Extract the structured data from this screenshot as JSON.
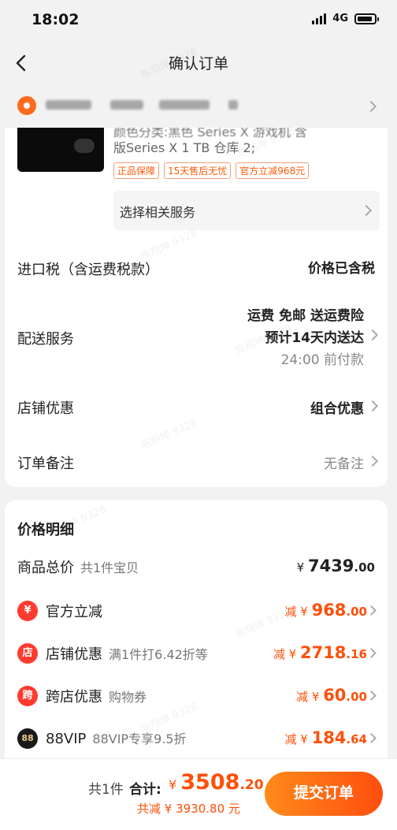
{
  "status": {
    "time": "18:02",
    "network": "4G"
  },
  "nav": {
    "title": "确认订单"
  },
  "product": {
    "title_line1": "颜色分类:黑色 Series X 游戏机 含",
    "title_line2": "版Series X 1 TB 仓库 2;",
    "tags": [
      "正品保障",
      "15天售后无忧",
      "官方立减968元"
    ],
    "service_label": "选择相关服务"
  },
  "rows": {
    "import_tax": {
      "label": "进口税（含运费税款）",
      "value": "价格已含税"
    },
    "delivery": {
      "label": "配送服务",
      "line1": "运费 免邮 送运费险",
      "line2": "预计14天内送达",
      "line3": "24:00 前付款"
    },
    "shop_discount": {
      "label": "店铺优惠",
      "value": "组合优惠"
    },
    "note": {
      "label": "订单备注",
      "value": "无备注"
    }
  },
  "price_detail": {
    "title": "价格明细",
    "total": {
      "label": "商品总价",
      "sub": "共1件宝贝",
      "prefix": "¥ ",
      "int": "7439",
      "dec": ".00"
    },
    "items": [
      {
        "icon": "¥",
        "label": "官方立减",
        "sub": "",
        "prefix": "减 ¥ ",
        "int": "968",
        "dec": ".00",
        "color": "#ff3b30"
      },
      {
        "icon": "店",
        "label": "店铺优惠",
        "sub": "满1件打6.42折等",
        "prefix": "减 ¥ ",
        "int": "2718",
        "dec": ".16",
        "color": "#ff3b30"
      },
      {
        "icon": "跨",
        "label": "跨店优惠",
        "sub": "购物券",
        "prefix": "减 ¥ ",
        "int": "60",
        "dec": ".00",
        "color": "#ff3b30"
      },
      {
        "icon": "88",
        "label": "88VIP",
        "sub": "88VIP专享9.5折",
        "prefix": "减 ¥ ",
        "int": "184",
        "dec": ".64",
        "color": "#1a1a1a"
      }
    ]
  },
  "bottom": {
    "count": "共1件",
    "total_label": "合计:",
    "prefix": "¥ ",
    "total_int": "3508",
    "total_dec": ".20",
    "saved": "共减 ¥ 3930.80 元",
    "submit": "提交订单"
  },
  "watermark": "陈翔坤 9328"
}
